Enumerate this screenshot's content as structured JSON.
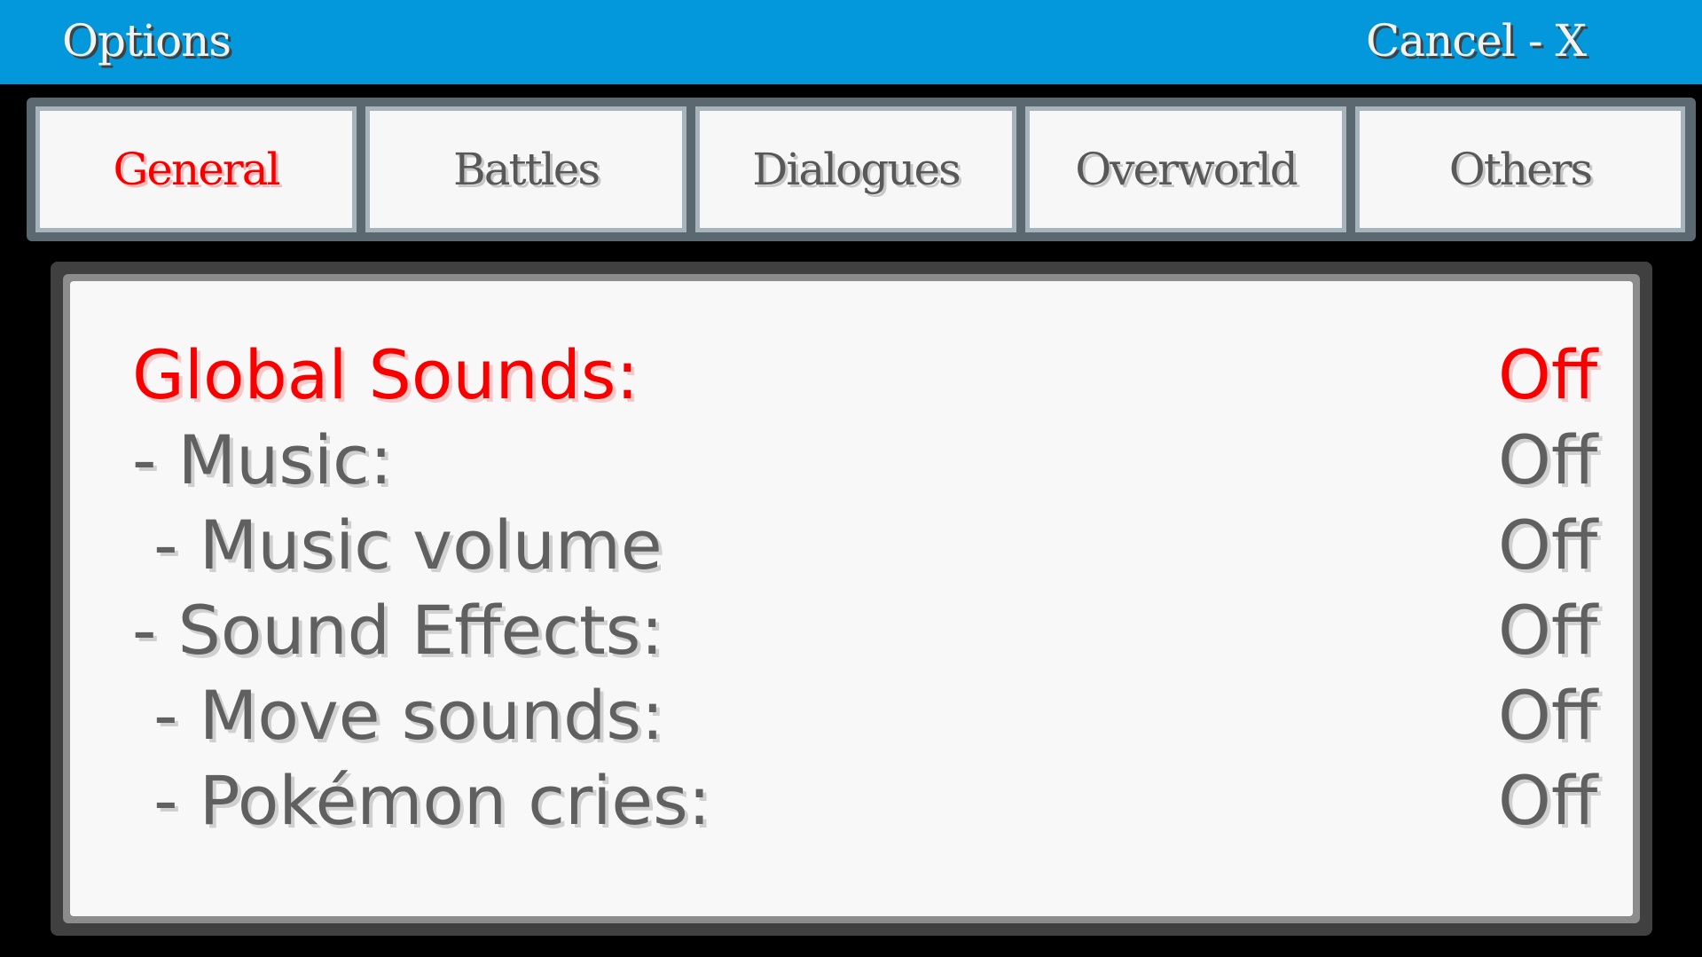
{
  "header": {
    "title": "Options",
    "cancel_label": "Cancel - X"
  },
  "tabs": [
    {
      "label": "General",
      "active": true
    },
    {
      "label": "Battles",
      "active": false
    },
    {
      "label": "Dialogues",
      "active": false
    },
    {
      "label": "Overworld",
      "active": false
    },
    {
      "label": "Others",
      "active": false
    }
  ],
  "options": [
    {
      "label": "Global Sounds:",
      "value": "Off",
      "selected": true
    },
    {
      "label": "- Music:",
      "value": "Off",
      "selected": false
    },
    {
      "label": " - Music volume",
      "value": "Off",
      "selected": false
    },
    {
      "label": "- Sound Effects:",
      "value": "Off",
      "selected": false
    },
    {
      "label": " - Move sounds:",
      "value": "Off",
      "selected": false
    },
    {
      "label": " - Pokémon cries:",
      "value": "Off",
      "selected": false
    }
  ],
  "colors": {
    "header_bg": "#0398dc",
    "selected_text": "#f80000",
    "normal_text": "#606060",
    "panel_bg": "#f8f8f8"
  }
}
